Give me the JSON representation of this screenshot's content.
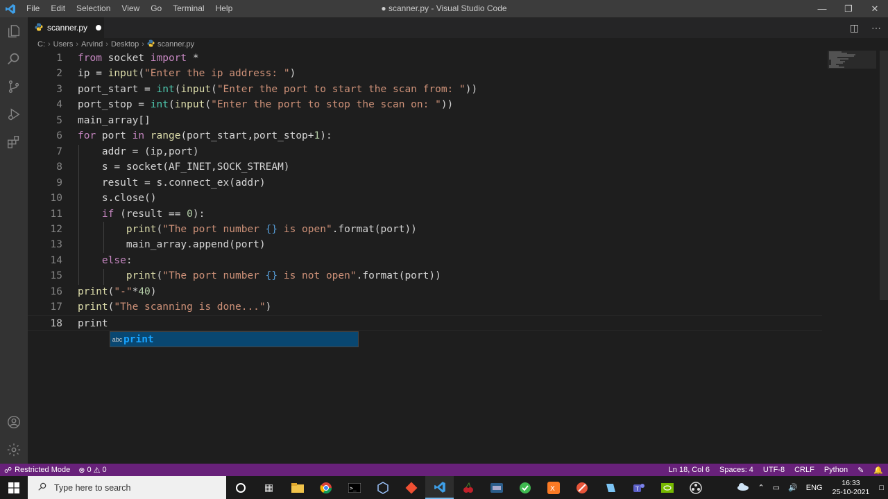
{
  "window": {
    "title": "● scanner.py - Visual Studio Code",
    "menu": [
      "File",
      "Edit",
      "Selection",
      "View",
      "Go",
      "Terminal",
      "Help"
    ]
  },
  "tab": {
    "filename": "scanner.py"
  },
  "breadcrumb": [
    "C:",
    "Users",
    "Arvind",
    "Desktop",
    "scanner.py"
  ],
  "editor": {
    "line_numbers": [
      "1",
      "2",
      "3",
      "4",
      "5",
      "6",
      "7",
      "8",
      "9",
      "10",
      "11",
      "12",
      "13",
      "14",
      "15",
      "16",
      "17",
      "18"
    ],
    "active_line": 18,
    "lines": [
      [
        [
          "kw",
          "from"
        ],
        [
          "pl",
          " socket "
        ],
        [
          "kw",
          "import"
        ],
        [
          "pl",
          " *"
        ]
      ],
      [
        [
          "pl",
          "ip = "
        ],
        [
          "fn",
          "input"
        ],
        [
          "pl",
          "("
        ],
        [
          "st",
          "\"Enter the ip address: \""
        ],
        [
          "pl",
          ")"
        ]
      ],
      [
        [
          "pl",
          "port_start = "
        ],
        [
          "bi",
          "int"
        ],
        [
          "pl",
          "("
        ],
        [
          "fn",
          "input"
        ],
        [
          "pl",
          "("
        ],
        [
          "st",
          "\"Enter the port to start the scan from: \""
        ],
        [
          "pl",
          "))"
        ]
      ],
      [
        [
          "pl",
          "port_stop = "
        ],
        [
          "bi",
          "int"
        ],
        [
          "pl",
          "("
        ],
        [
          "fn",
          "input"
        ],
        [
          "pl",
          "("
        ],
        [
          "st",
          "\"Enter the port to stop the scan on: \""
        ],
        [
          "pl",
          "))"
        ]
      ],
      [
        [
          "pl",
          "main_array[]"
        ]
      ],
      [
        [
          "kw",
          "for"
        ],
        [
          "pl",
          " port "
        ],
        [
          "kw",
          "in"
        ],
        [
          "pl",
          " "
        ],
        [
          "fn",
          "range"
        ],
        [
          "pl",
          "(port_start,port_stop+"
        ],
        [
          "nm",
          "1"
        ],
        [
          "pl",
          "):"
        ]
      ],
      [
        [
          "pl",
          "    addr = (ip,port)"
        ]
      ],
      [
        [
          "pl",
          "    s = socket(AF_INET,SOCK_STREAM)"
        ]
      ],
      [
        [
          "pl",
          "    result = s.connect_ex(addr)"
        ]
      ],
      [
        [
          "pl",
          "    s.close()"
        ]
      ],
      [
        [
          "pl",
          "    "
        ],
        [
          "kw",
          "if"
        ],
        [
          "pl",
          " (result == "
        ],
        [
          "nm",
          "0"
        ],
        [
          "pl",
          "):"
        ]
      ],
      [
        [
          "pl",
          "        "
        ],
        [
          "fn",
          "print"
        ],
        [
          "pl",
          "("
        ],
        [
          "st",
          "\"The port number "
        ],
        [
          "br",
          "{}"
        ],
        [
          "st",
          " is open\""
        ],
        [
          "pl",
          ".format(port))"
        ]
      ],
      [
        [
          "pl",
          "        main_array.append(port)"
        ]
      ],
      [
        [
          "pl",
          "    "
        ],
        [
          "kw",
          "else"
        ],
        [
          "pl",
          ":"
        ]
      ],
      [
        [
          "pl",
          "        "
        ],
        [
          "fn",
          "print"
        ],
        [
          "pl",
          "("
        ],
        [
          "st",
          "\"The port number "
        ],
        [
          "br",
          "{}"
        ],
        [
          "st",
          " is not open\""
        ],
        [
          "pl",
          ".format(port))"
        ]
      ],
      [
        [
          "fn",
          "print"
        ],
        [
          "pl",
          "("
        ],
        [
          "st",
          "\"-\""
        ],
        [
          "pl",
          "*"
        ],
        [
          "nm",
          "40"
        ],
        [
          "pl",
          ")"
        ]
      ],
      [
        [
          "fn",
          "print"
        ],
        [
          "pl",
          "("
        ],
        [
          "st",
          "\"The scanning is done...\""
        ],
        [
          "pl",
          ")"
        ]
      ],
      [
        [
          "pl",
          "print"
        ]
      ]
    ]
  },
  "suggestion": {
    "kind": "abc",
    "label": "print"
  },
  "statusbar": {
    "mode": "Restricted Mode",
    "errors": "0",
    "warnings": "0",
    "position": "Ln 18, Col 6",
    "spaces": "Spaces: 4",
    "encoding": "UTF-8",
    "eol": "CRLF",
    "language": "Python"
  },
  "taskbar": {
    "search_placeholder": "Type here to search",
    "language": "ENG",
    "time": "16:33",
    "date": "25-10-2021"
  },
  "colors": {
    "statusbar": "#68217a",
    "editor_bg": "#1e1e1e",
    "keyword": "#c586c0",
    "function": "#dcdcaa",
    "string": "#ce9178"
  }
}
